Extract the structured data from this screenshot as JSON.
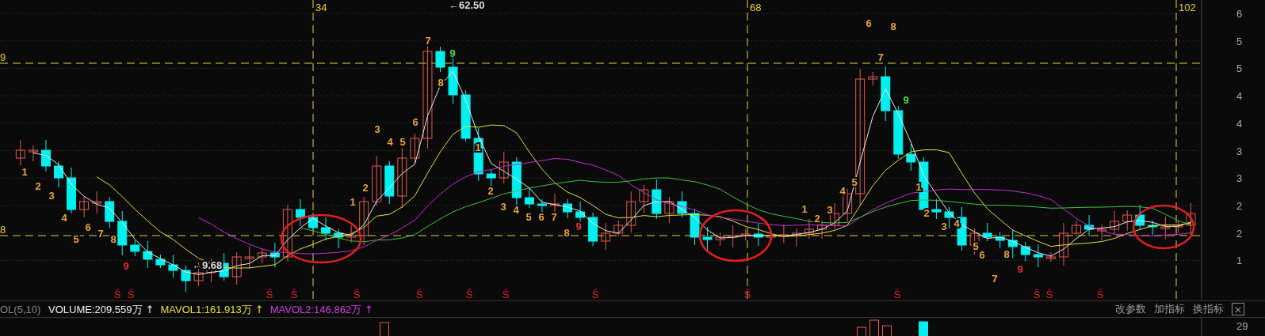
{
  "chart": {
    "period_markers": [
      "34",
      "68",
      "102"
    ],
    "left_axis": [
      "9",
      "8"
    ],
    "right_axis": [
      "6",
      "5",
      "5",
      "4",
      "4",
      "3",
      "3",
      "2",
      "2",
      "1"
    ],
    "price_markers": [
      "←62.50",
      "←9.68"
    ],
    "count_labels": [
      {
        "text": "1",
        "color": "#e8a33c"
      },
      {
        "text": "2",
        "color": "#e8a33c"
      },
      {
        "text": "3",
        "color": "#e8a33c"
      },
      {
        "text": "4",
        "color": "#e8a33c"
      },
      {
        "text": "5",
        "color": "#e8a33c"
      },
      {
        "text": "6",
        "color": "#e8a33c"
      },
      {
        "text": "7",
        "color": "#e8a33c"
      },
      {
        "text": "8",
        "color": "#e8a33c"
      },
      {
        "text": "9",
        "color": "#e03030"
      },
      {
        "text": "1",
        "color": "#e8a33c"
      },
      {
        "text": "2",
        "color": "#e8a33c"
      },
      {
        "text": "3",
        "color": "#e8a33c"
      },
      {
        "text": "4",
        "color": "#e8a33c"
      },
      {
        "text": "5",
        "color": "#e8a33c"
      },
      {
        "text": "6",
        "color": "#e8a33c"
      },
      {
        "text": "7",
        "color": "#e8a33c"
      },
      {
        "text": "8",
        "color": "#e8a33c"
      },
      {
        "text": "9",
        "color": "#4ee04e"
      },
      {
        "text": "1",
        "color": "#e8a33c"
      },
      {
        "text": "2",
        "color": "#e8a33c"
      },
      {
        "text": "3",
        "color": "#e8a33c"
      },
      {
        "text": "4",
        "color": "#e8a33c"
      },
      {
        "text": "5",
        "color": "#e8a33c"
      },
      {
        "text": "6",
        "color": "#e8a33c"
      },
      {
        "text": "7",
        "color": "#e8a33c"
      },
      {
        "text": "8",
        "color": "#e8a33c"
      },
      {
        "text": "9",
        "color": "#e03030"
      },
      {
        "text": "1",
        "color": "#e8a33c"
      },
      {
        "text": "2",
        "color": "#e8a33c"
      },
      {
        "text": "3",
        "color": "#e8a33c"
      },
      {
        "text": "4",
        "color": "#e8a33c"
      },
      {
        "text": "5",
        "color": "#e8a33c"
      },
      {
        "text": "6",
        "color": "#e8a33c"
      },
      {
        "text": "7",
        "color": "#e8a33c"
      },
      {
        "text": "8",
        "color": "#e8a33c"
      },
      {
        "text": "9",
        "color": "#4ee04e"
      },
      {
        "text": "1",
        "color": "#e8a33c"
      },
      {
        "text": "2",
        "color": "#e8a33c"
      },
      {
        "text": "3",
        "color": "#e8a33c"
      },
      {
        "text": "4",
        "color": "#e8a33c"
      },
      {
        "text": "5",
        "color": "#e8a33c"
      },
      {
        "text": "6",
        "color": "#e8a33c"
      },
      {
        "text": "7",
        "color": "#e8a33c"
      },
      {
        "text": "8",
        "color": "#e8a33c"
      },
      {
        "text": "9",
        "color": "#e03030"
      }
    ],
    "signal_marks": [
      "Ŝ",
      "Ŝ",
      "Ŝ",
      "Ŝ",
      "Ŝ",
      "Ŝ",
      "Ŝ",
      "Ŝ",
      "Ŝ",
      "Ŝ",
      "Ŝ",
      "Ŝ",
      "Ŝ",
      "Ŝ"
    ]
  },
  "indicator_bar": {
    "name": "OL(5,10)",
    "values": [
      {
        "text": "VOLUME:209.559万",
        "trend": "↑",
        "color": "#f0f0f0"
      },
      {
        "text": "MAVOL1:161.913万",
        "trend": "↑",
        "color": "#e6e03a"
      },
      {
        "text": "MAVOL2:146.862万",
        "trend": "↑",
        "color": "#d040e0"
      }
    ],
    "buttons": [
      "改参数",
      "加指标",
      "换指标"
    ],
    "close": "×"
  },
  "volume_panel": {
    "axis": [
      "29"
    ]
  }
}
